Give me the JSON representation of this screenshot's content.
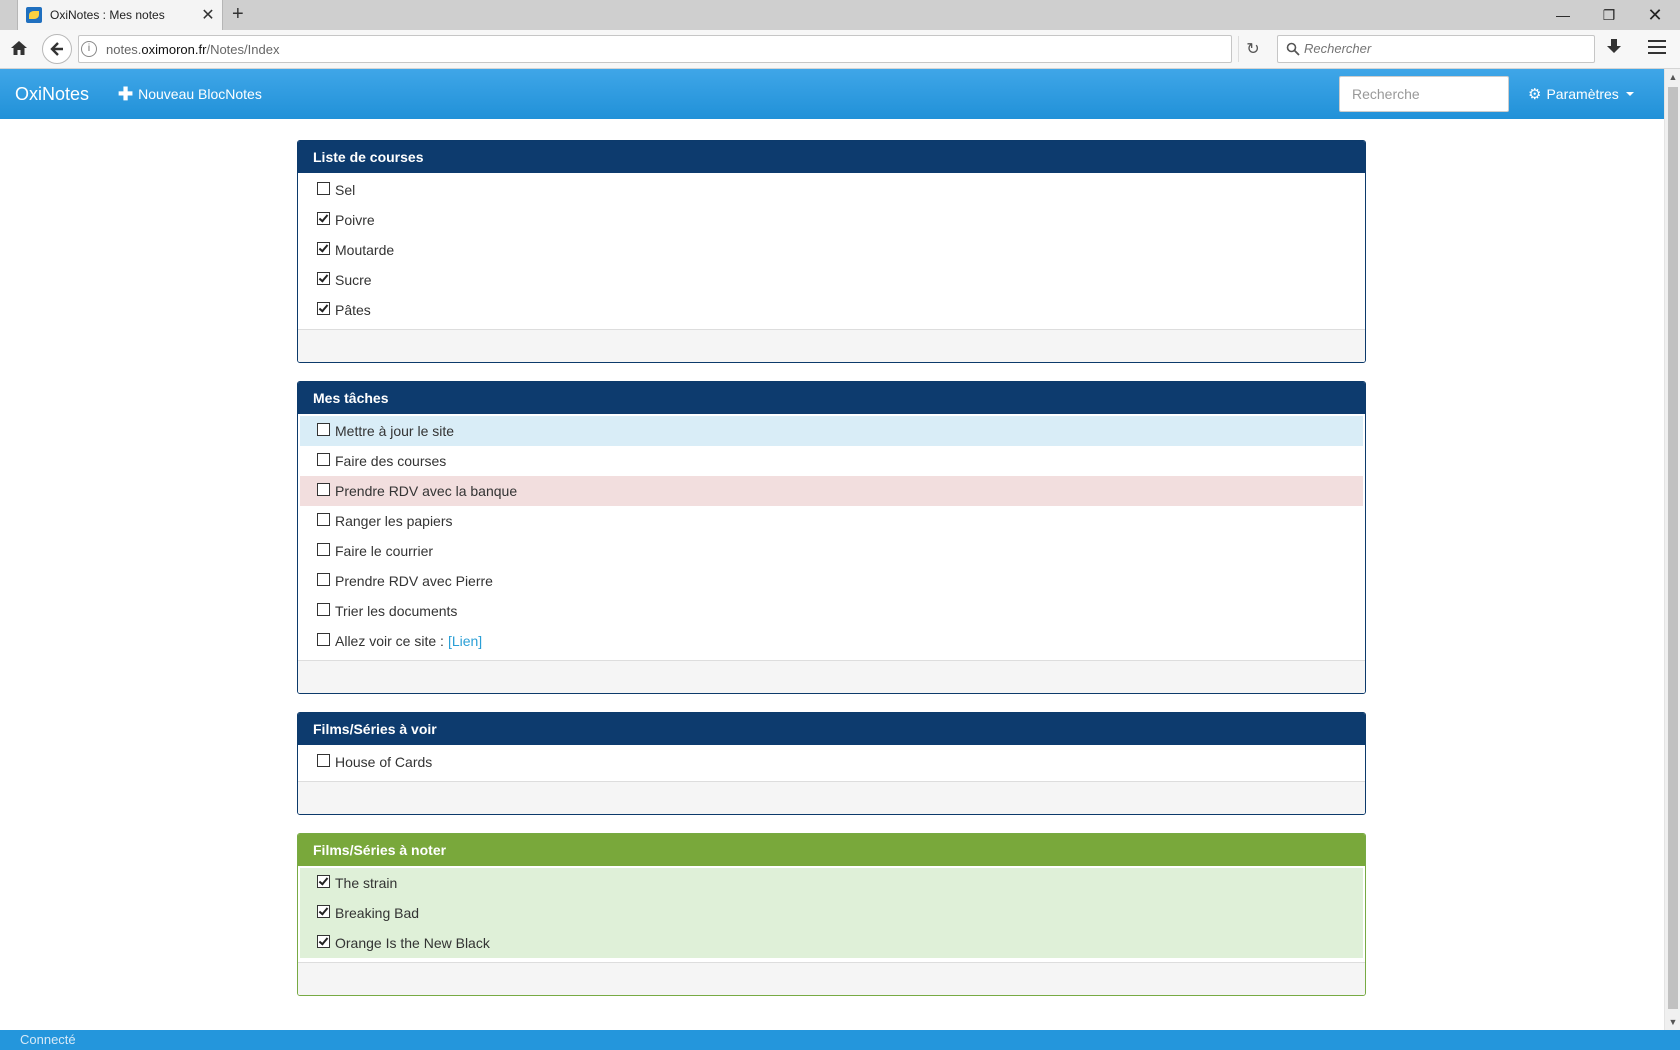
{
  "browser": {
    "tab_title": "OxiNotes : Mes notes",
    "url_host": "notes.oximoron.fr",
    "url_prefix": "notes.",
    "url_domain": "oximoron.fr",
    "url_path": "/Notes/Index",
    "search_placeholder": "Rechercher"
  },
  "app": {
    "brand": "OxiNotes",
    "new_note_label": "Nouveau BlocNotes",
    "search_placeholder": "Recherche",
    "settings_label": "Paramètres",
    "accent": "#2a9fd6"
  },
  "panels": [
    {
      "title": "Liste de courses",
      "color": "#0d3b6e",
      "items": [
        {
          "label": "Sel",
          "checked": false,
          "style": ""
        },
        {
          "label": "Poivre",
          "checked": true,
          "style": ""
        },
        {
          "label": "Moutarde",
          "checked": true,
          "style": ""
        },
        {
          "label": "Sucre",
          "checked": true,
          "style": ""
        },
        {
          "label": "Pâtes",
          "checked": true,
          "style": ""
        }
      ]
    },
    {
      "title": "Mes tâches",
      "color": "#0d3b6e",
      "items": [
        {
          "label": "Mettre à jour le site",
          "checked": false,
          "style": "info"
        },
        {
          "label": "Faire des courses",
          "checked": false,
          "style": ""
        },
        {
          "label": "Prendre RDV avec la banque",
          "checked": false,
          "style": "danger"
        },
        {
          "label": "Ranger les papiers",
          "checked": false,
          "style": ""
        },
        {
          "label": "Faire le courrier",
          "checked": false,
          "style": ""
        },
        {
          "label": "Prendre RDV avec Pierre",
          "checked": false,
          "style": ""
        },
        {
          "label": "Trier les documents",
          "checked": false,
          "style": ""
        },
        {
          "label": "Allez voir ce site :",
          "checked": false,
          "style": "",
          "link": "[Lien]"
        }
      ]
    },
    {
      "title": "Films/Séries à voir",
      "color": "#0d3b6e",
      "items": [
        {
          "label": "House of Cards",
          "checked": false,
          "style": ""
        }
      ]
    },
    {
      "title": "Films/Séries à noter",
      "color": "#79a83b",
      "items": [
        {
          "label": "The strain",
          "checked": true,
          "style": "success"
        },
        {
          "label": "Breaking Bad",
          "checked": true,
          "style": "success"
        },
        {
          "label": "Orange Is the New Black",
          "checked": true,
          "style": "success"
        }
      ]
    }
  ],
  "status": "Connecté"
}
